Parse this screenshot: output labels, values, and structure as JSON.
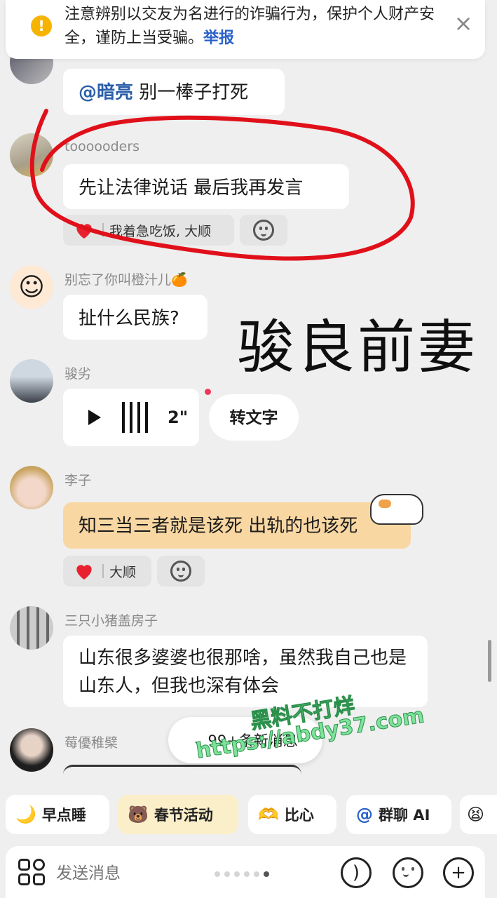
{
  "banner": {
    "text": "注意辨别以交友为名进行的诈骗行为，保护个人财产安全，谨防上当受骗。",
    "link": "举报",
    "icon": "warning-icon",
    "close_icon": "close-icon"
  },
  "messages": [
    {
      "name": "",
      "mention": "@暗亮",
      "text": " 别一棒子打死"
    },
    {
      "name": "toooooders",
      "text": "先让法律说话 最后我再发言",
      "reaction": "我着急吃饭, 大顺"
    },
    {
      "name": "别忘了你叫橙汁儿🍊",
      "text": "扯什么民族?"
    },
    {
      "name": "骏劣",
      "voice_duration": "2\"",
      "transcribe": "转文字"
    },
    {
      "name": "李子",
      "text": "知三当三者就是该死 出轨的也该死",
      "reaction": "大顺"
    },
    {
      "name": "三只小猪盖房子",
      "text": "山东很多婆婆也很那啥，虽然我自己也是山东人，但我也深有体会"
    },
    {
      "name": "莓優稚檗"
    }
  ],
  "overlay_caption": "骏良前妻",
  "new_messages": "99+条新消息",
  "watermark": {
    "line1": "黑料不打烊",
    "line2": "https://abdy37.com"
  },
  "quick_actions": [
    {
      "label": "早点睡",
      "icon": "moon-icon"
    },
    {
      "label": "春节活动",
      "icon": "bear-icon"
    },
    {
      "label": "比心",
      "icon": "heart-hand-icon"
    },
    {
      "label": "群聊 AI",
      "icon": "at-icon"
    }
  ],
  "input": {
    "placeholder": "发送消息"
  },
  "colors": {
    "accent_blue": "#2b62c8",
    "highlight_bubble": "#f9d7a3",
    "annotation_red": "#e0101a"
  }
}
